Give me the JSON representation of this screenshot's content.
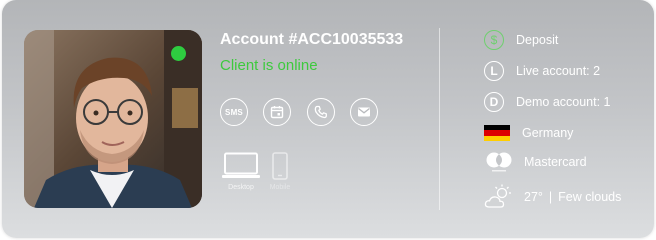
{
  "account": {
    "title": "Account #ACC10035533",
    "status_text": "Client is online",
    "status_color": "#2ecc40"
  },
  "actions": [
    {
      "name": "sms",
      "label": "SMS",
      "icon": "sms-icon"
    },
    {
      "name": "calendar",
      "icon": "calendar-icon"
    },
    {
      "name": "phone",
      "icon": "phone-icon"
    },
    {
      "name": "email",
      "icon": "envelope-icon"
    }
  ],
  "devices": [
    {
      "name": "desktop",
      "label": "Desktop",
      "icon": "monitor-icon",
      "active": true
    },
    {
      "name": "mobile",
      "label": "Mobile",
      "icon": "phone-device-icon",
      "active": false
    }
  ],
  "details": {
    "deposit": {
      "label": "Deposit",
      "icon": "dollar-icon"
    },
    "live_account": {
      "badge": "L",
      "label": "Live account: 2"
    },
    "demo_account": {
      "badge": "D",
      "label": "Demo account: 1"
    },
    "country": {
      "label": "Germany",
      "flag_colors": [
        "#000000",
        "#dd0000",
        "#ffce00"
      ]
    },
    "card": {
      "label": "Mastercard",
      "icon": "mastercard-icon"
    },
    "weather": {
      "temperature": "27°",
      "separator": "|",
      "condition": "Few clouds",
      "icon": "partly-cloudy-icon"
    }
  }
}
